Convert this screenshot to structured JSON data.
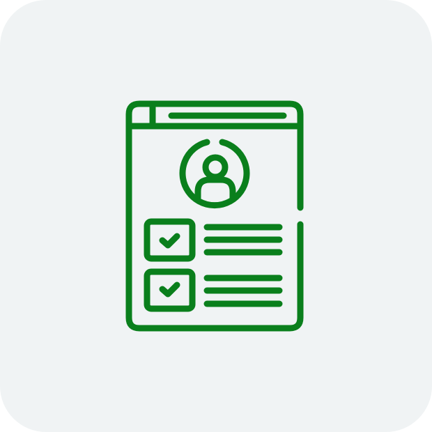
{
  "tile": {
    "background": "#f0f3f4"
  },
  "icon": {
    "name": "profile-checklist-icon",
    "stroke_color": "#0a7f1c"
  }
}
